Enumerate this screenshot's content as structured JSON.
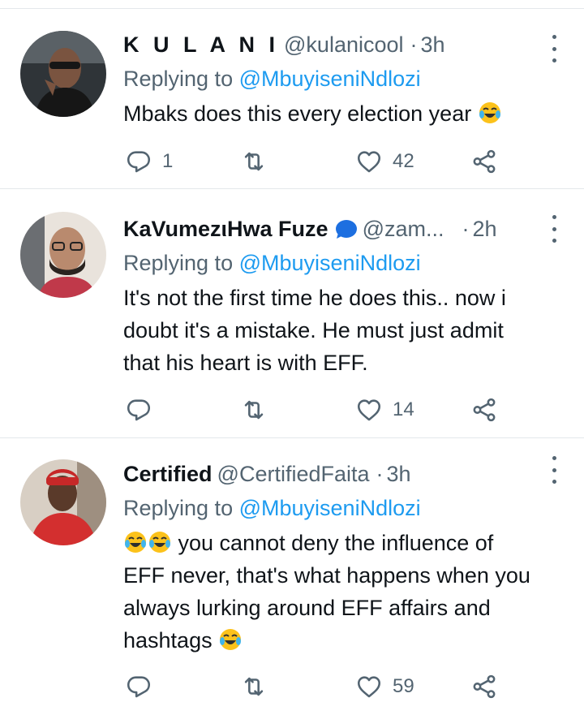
{
  "tweets": [
    {
      "name": "K U L A N I",
      "handle": "@kulanicool",
      "dot": "·",
      "time": "3h",
      "replying_prefix": "Replying to",
      "replying_to": "@MbuyiseniNdlozi",
      "text": "Mbaks does this every election year",
      "reply_count": "1",
      "retweet_count": "",
      "like_count": "42"
    },
    {
      "name": "KaVumezιHwa Fuze",
      "handle": "@zam...",
      "dot": "·",
      "time": "2h",
      "replying_prefix": "Replying to",
      "replying_to": "@MbuyiseniNdlozi",
      "text": "It's not the first time he does this.. now i doubt it's a mistake. He must just admit that his heart is with EFF.",
      "reply_count": "",
      "retweet_count": "",
      "like_count": "14"
    },
    {
      "name": "Certified",
      "handle": "@CertifiedFaita",
      "dot": "·",
      "time": "3h",
      "replying_prefix": "Replying to",
      "replying_to": "@MbuyiseniNdlozi",
      "text": "you cannot deny the influence of EFF never, that's what happens when you always lurking around EFF affairs and hashtags",
      "reply_count": "",
      "retweet_count": "",
      "like_count": "59"
    }
  ],
  "colors": {
    "text": "#0f1419",
    "muted": "#536471",
    "link": "#1d9bf0",
    "divider": "#e4e8eb"
  },
  "icons": [
    "reply-icon",
    "retweet-icon",
    "like-icon",
    "share-icon",
    "more-icon",
    "verified-badge",
    "laughing-emoji"
  ]
}
